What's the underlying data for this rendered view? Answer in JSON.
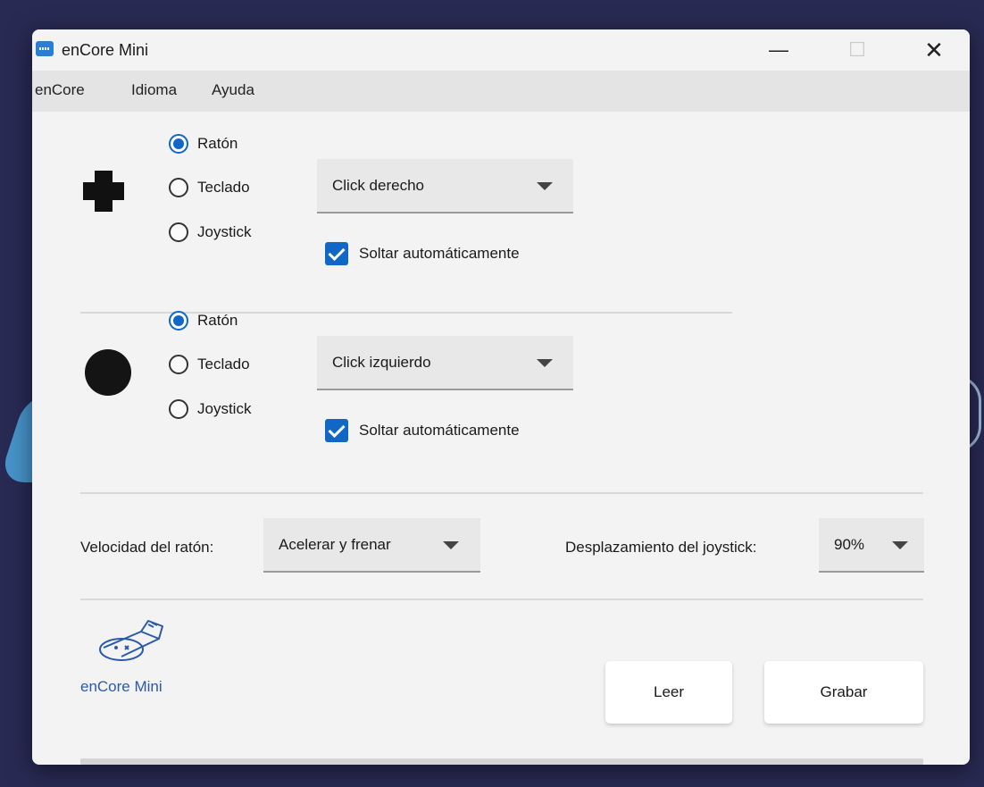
{
  "window": {
    "title": "enCore Mini"
  },
  "window_controls": {
    "minimize": "—",
    "maximize": "☐",
    "close": "✕"
  },
  "menu": [
    "enCore",
    "Idioma",
    "Ayuda"
  ],
  "sections": [
    {
      "icon": "dpad-cross-icon",
      "radios": [
        {
          "label": "Ratón",
          "checked": true
        },
        {
          "label": "Teclado",
          "checked": false
        },
        {
          "label": "Joystick",
          "checked": false
        }
      ],
      "dropdown": "Click derecho",
      "checkbox": {
        "label": "Soltar automáticamente",
        "checked": true
      }
    },
    {
      "icon": "round-button-icon",
      "radios": [
        {
          "label": "Ratón",
          "checked": true
        },
        {
          "label": "Teclado",
          "checked": false
        },
        {
          "label": "Joystick",
          "checked": false
        }
      ],
      "dropdown": "Click izquierdo",
      "checkbox": {
        "label": "Soltar automáticamente",
        "checked": true
      }
    }
  ],
  "mouse_speed": {
    "label": "Velocidad del ratón:",
    "value": "Acelerar y frenar"
  },
  "joystick_displacement": {
    "label": "Desplazamiento del joystick:",
    "value": "90%"
  },
  "device": {
    "label": "enCore Mini",
    "icon": "usb-device-icon"
  },
  "buttons": {
    "read": "Leer",
    "write": "Grabar"
  },
  "progress": {
    "value": 0
  },
  "colors": {
    "accent": "#1067c6",
    "device_label": "#2c5aa8",
    "desktop": "#282a54"
  }
}
